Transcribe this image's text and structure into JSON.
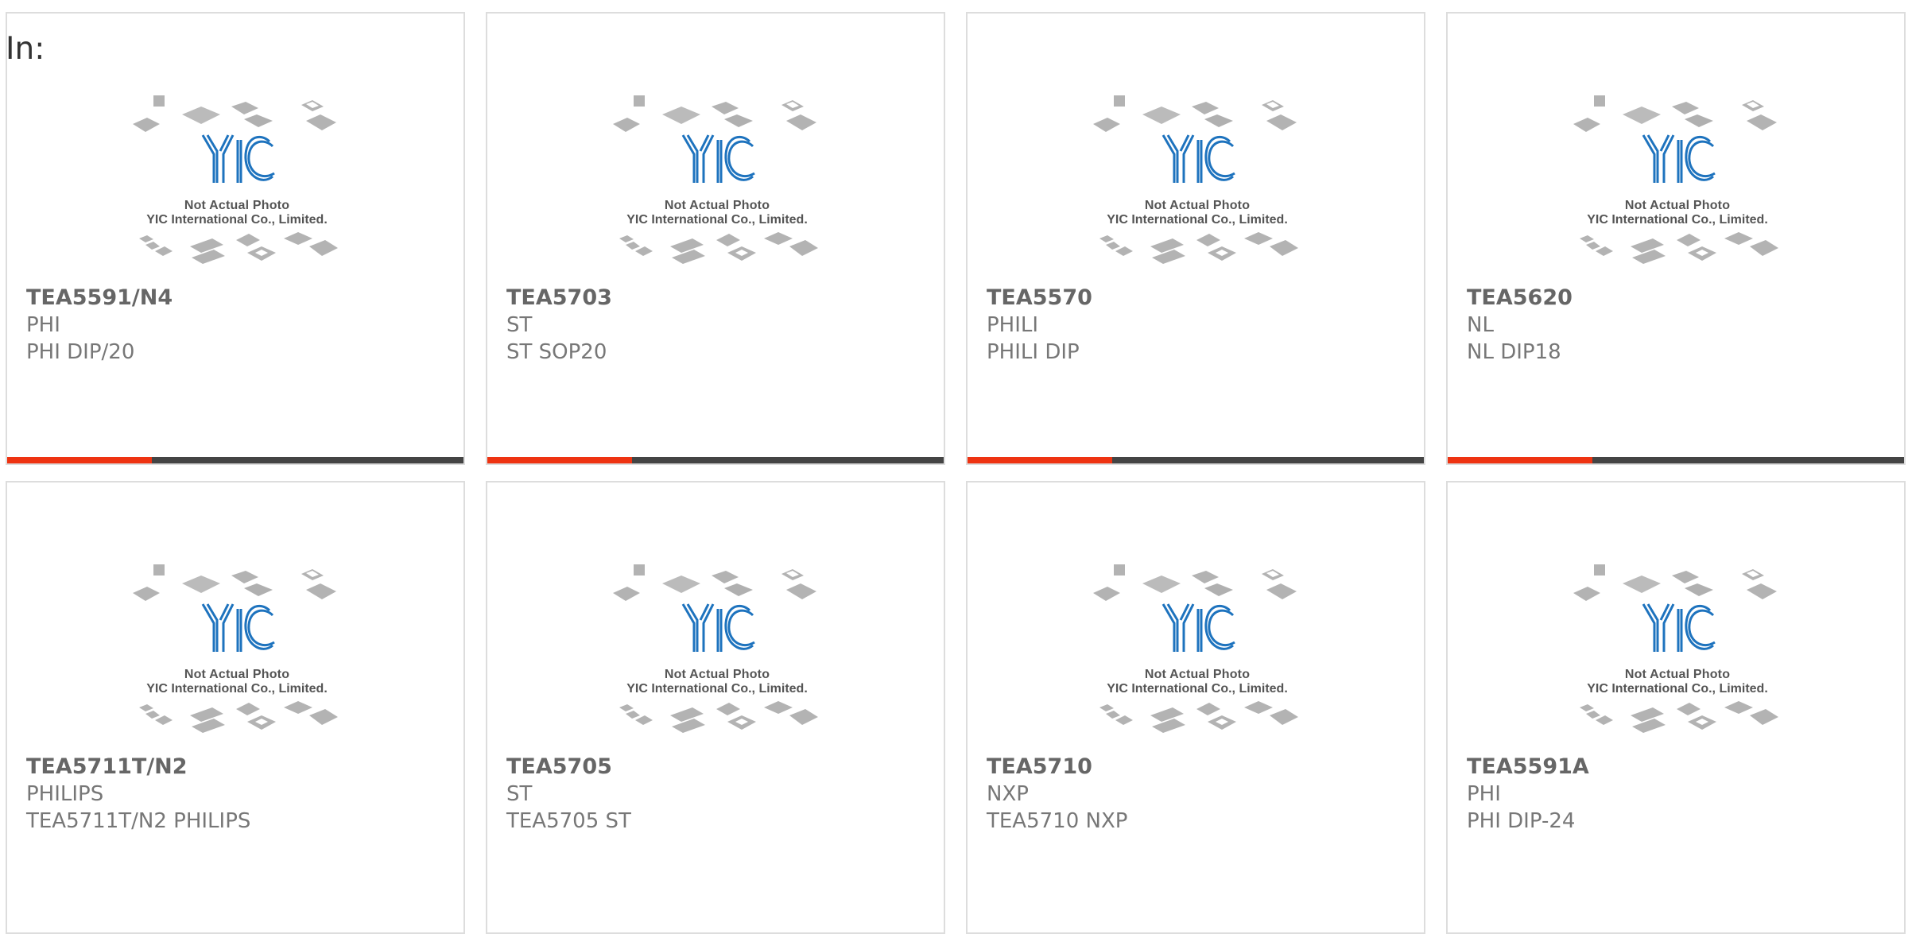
{
  "filter_label": "In:",
  "placeholder_image": {
    "line1": "Not Actual Photo",
    "line2": "YIC International Co., Limited."
  },
  "colors": {
    "accent": "#EE3311",
    "bar": "#444444",
    "logo_blue": "#1E73BE",
    "chip_gray": "#B3B3B3"
  },
  "products": [
    {
      "part": "TEA5591/N4",
      "brand": "PHI",
      "package": "PHI DIP/20"
    },
    {
      "part": "TEA5703",
      "brand": "ST",
      "package": "ST SOP20"
    },
    {
      "part": "TEA5570",
      "brand": "PHILI",
      "package": "PHILI DIP"
    },
    {
      "part": "TEA5620",
      "brand": "NL",
      "package": "NL DIP18"
    },
    {
      "part": "TEA5711T/N2",
      "brand": "PHILIPS",
      "package": "TEA5711T/N2 PHILIPS"
    },
    {
      "part": "TEA5705",
      "brand": "ST",
      "package": "TEA5705 ST"
    },
    {
      "part": "TEA5710",
      "brand": "NXP",
      "package": "TEA5710 NXP"
    },
    {
      "part": "TEA5591A",
      "brand": "PHI",
      "package": "PHI DIP-24"
    }
  ]
}
